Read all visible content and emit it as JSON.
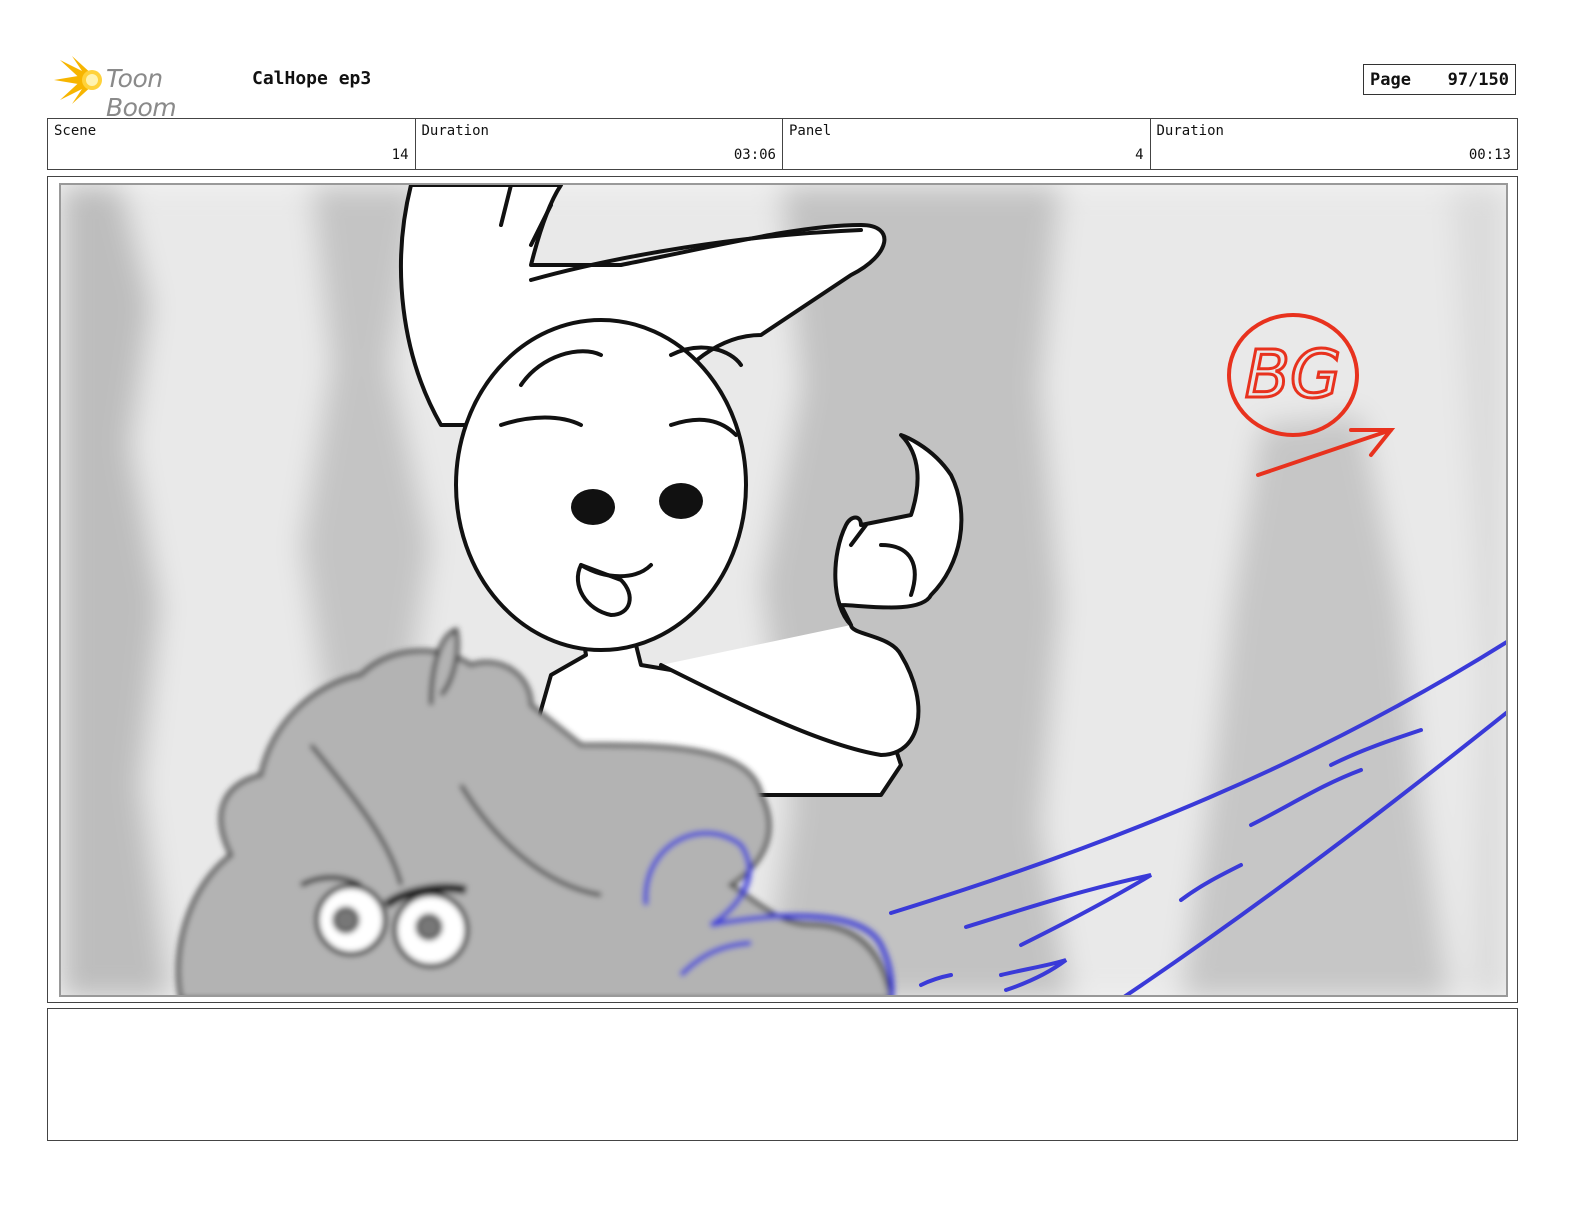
{
  "header": {
    "logo_text": "Toon Boom",
    "project_title": "CalHope ep3",
    "page_label": "Page",
    "page_number": "97/150"
  },
  "info": {
    "scene_label": "Scene",
    "scene_value": "14",
    "scene_duration_label": "Duration",
    "scene_duration_value": "03:06",
    "panel_label": "Panel",
    "panel_value": "4",
    "panel_duration_label": "Duration",
    "panel_duration_value": "00:13"
  },
  "panel": {
    "annotation_text": "BG",
    "annotation_color": "#e8321e",
    "action_line_color": "#3a3ad8"
  },
  "notes": {
    "text": ""
  }
}
